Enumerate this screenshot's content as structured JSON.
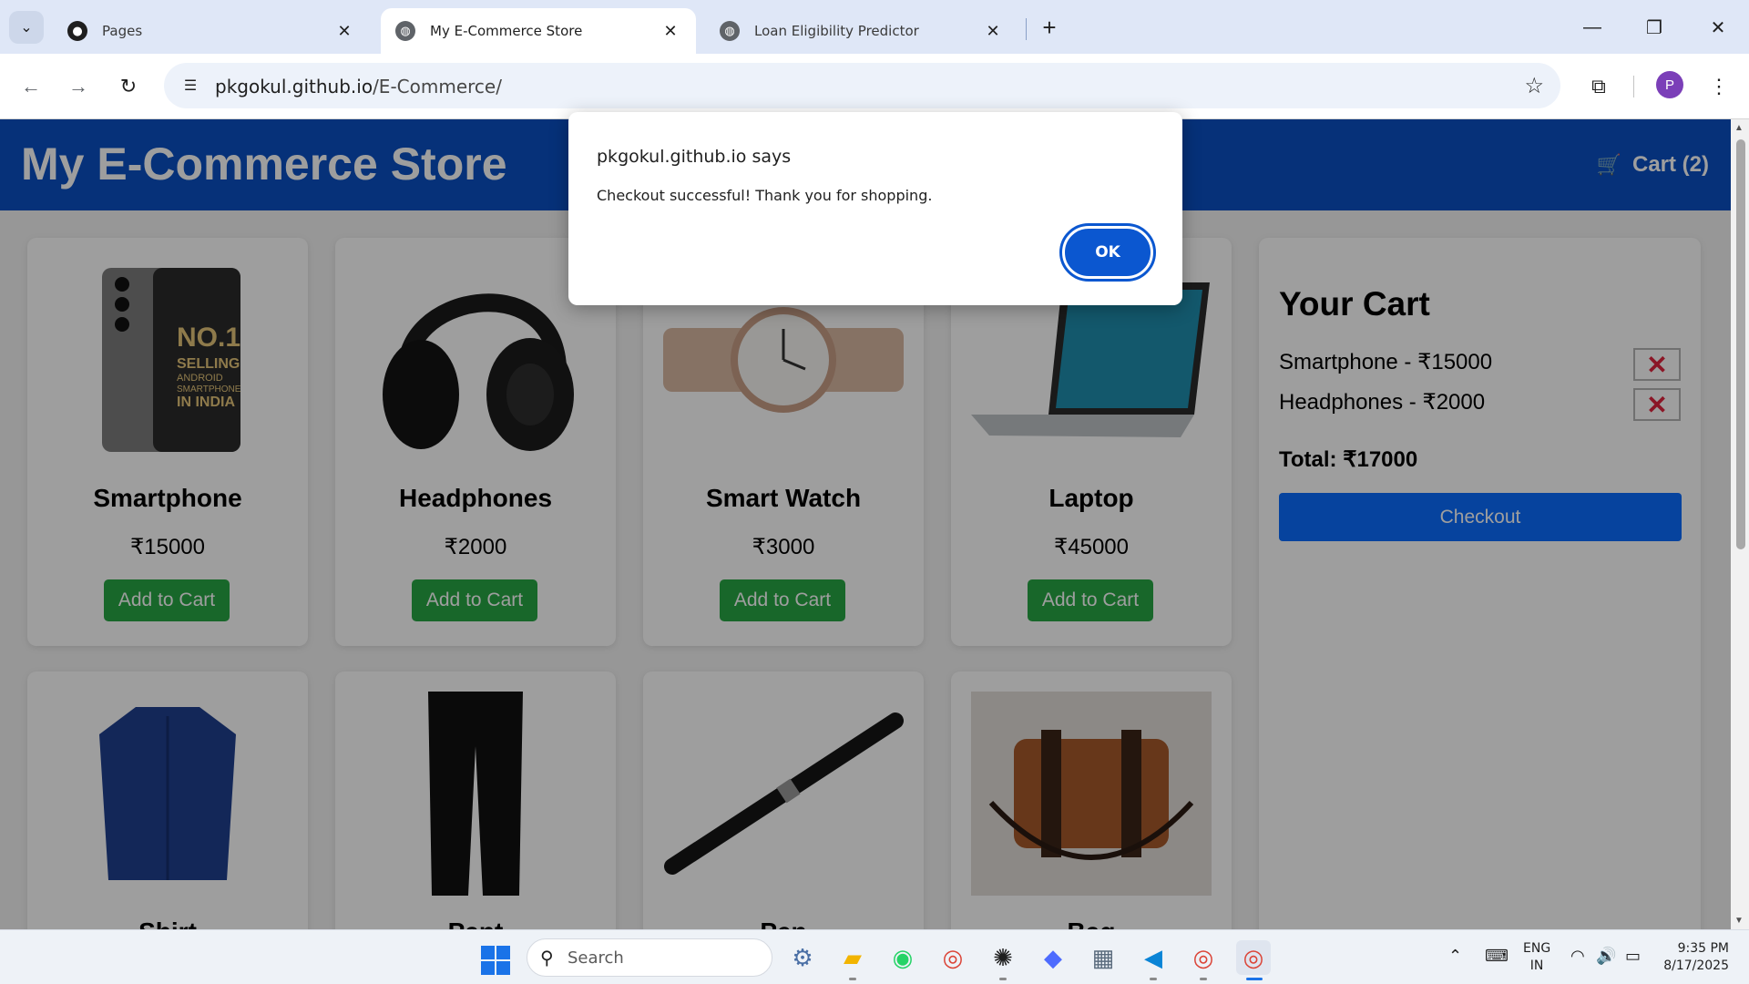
{
  "browser": {
    "tabs": [
      {
        "title": "Pages",
        "icon": "github-icon"
      },
      {
        "title": "My E-Commerce Store",
        "icon": "globe-icon"
      },
      {
        "title": "Loan Eligibility Predictor",
        "icon": "globe-icon"
      }
    ],
    "url_host": "pkgokul.github.io",
    "url_path": "/E-Commerce/",
    "profile_initial": "P"
  },
  "store": {
    "title": "My E-Commerce Store",
    "cart_link": "Cart (2)",
    "products": [
      {
        "name": "Smartphone",
        "price": "₹15000",
        "button": "Add to Cart",
        "image": "smartphone"
      },
      {
        "name": "Headphones",
        "price": "₹2000",
        "button": "Add to Cart",
        "image": "headphones"
      },
      {
        "name": "Smart Watch",
        "price": "₹3000",
        "button": "Add to Cart",
        "image": "watch"
      },
      {
        "name": "Laptop",
        "price": "₹45000",
        "button": "Add to Cart",
        "image": "laptop"
      },
      {
        "name": "Shirt",
        "image": "shirt"
      },
      {
        "name": "Pant",
        "image": "pant"
      },
      {
        "name": "Pen",
        "image": "pen"
      },
      {
        "name": "Bag",
        "image": "bag"
      }
    ],
    "phone_text": {
      "l1": "NO.1",
      "l2": "SELLING",
      "l3": "ANDROID",
      "l4": "SMARTPHONE",
      "l5": "IN INDIA"
    },
    "cart": {
      "heading": "Your Cart",
      "items": [
        "Smartphone - ₹15000",
        "Headphones - ₹2000"
      ],
      "remove_label": "✕",
      "total": "Total: ₹17000",
      "checkout": "Checkout"
    }
  },
  "dialog": {
    "title": "pkgokul.github.io says",
    "message": "Checkout successful! Thank you for shopping.",
    "ok": "OK"
  },
  "taskbar": {
    "search_placeholder": "Search",
    "lang_line1": "ENG",
    "lang_line2": "IN",
    "time": "9:35 PM",
    "date": "8/17/2025"
  },
  "colors": {
    "header_blue": "#0a4fc4",
    "add_green": "#28a745",
    "checkout_blue": "#0a6cff",
    "remove_red": "#e0243e",
    "dialog_ok": "#0b57d0"
  }
}
